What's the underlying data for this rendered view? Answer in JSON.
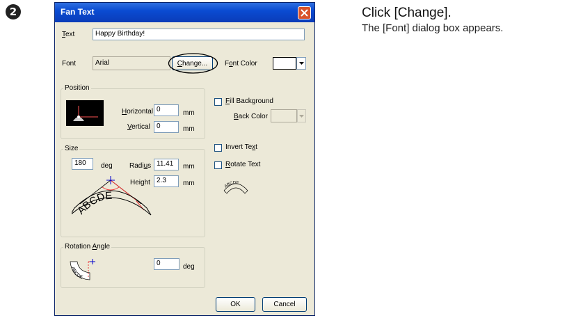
{
  "step": {
    "number": "2",
    "title": "Click [Change].",
    "description": "The [Font] dialog box appears."
  },
  "dialog": {
    "title": "Fan Text",
    "text_label_u": "T",
    "text_label_rest": "ext",
    "text_value": "Happy Birthday!",
    "font_label": "Font",
    "font_value": "Arial",
    "change_button_u": "C",
    "change_button_rest": "hange...",
    "font_color_label_pre": "F",
    "font_color_label_u": "o",
    "font_color_label_rest": "nt Color",
    "font_color": "#ffffff",
    "position": {
      "label": "Position",
      "horizontal_u": "H",
      "horizontal_rest": "orizontal",
      "horizontal_value": "0",
      "vertical_u": "V",
      "vertical_rest": "ertical",
      "vertical_value": "0",
      "unit": "mm"
    },
    "fill_background": {
      "u": "F",
      "rest": "ill Background",
      "checked": false
    },
    "back_color_u": "B",
    "back_color_rest": "ack Color",
    "invert_text": {
      "pre": "Invert Te",
      "u": "x",
      "rest": "t",
      "checked": false
    },
    "rotate_text": {
      "u": "R",
      "rest": "otate Text",
      "checked": false
    },
    "size": {
      "label": "Size",
      "angle_value": "180",
      "angle_unit": "deg",
      "radius_pre": "Radi",
      "radius_u": "u",
      "radius_rest": "s",
      "radius_value": "11.41",
      "height_pre": "Hei",
      "height_u": "g",
      "height_rest": "ht",
      "height_value": "2.3",
      "unit": "mm",
      "illustration_text": "ABCDE"
    },
    "rotation": {
      "label_pre": "Rotation ",
      "label_u": "A",
      "label_rest": "ngle",
      "value": "0",
      "unit": "deg",
      "illustration_text": "ABCDE"
    },
    "rotate_preview_text": "ABCDE",
    "ok_button": "OK",
    "cancel_button": "Cancel"
  }
}
